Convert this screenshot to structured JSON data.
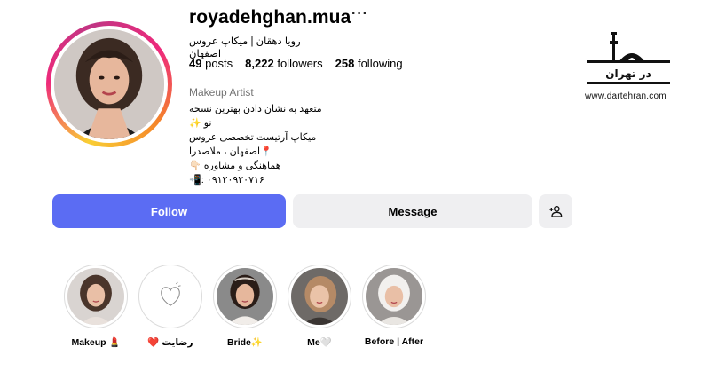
{
  "profile": {
    "username": "royadehghan.mua",
    "more_label": "···",
    "full_name": "رویا دهقان | میکاپ عروس اصفهان",
    "stats": {
      "posts_count": "49",
      "posts_label": "posts",
      "followers_count": "8,222",
      "followers_label": "followers",
      "following_count": "258",
      "following_label": "following"
    },
    "category": "Makeup Artist",
    "bio": [
      "متعهد به نشان دادن بهترین نسخه تو ✨",
      "میکاپ آرتیست تخصصی عروس",
      "📍اصفهان ، ملاصدرا",
      "هماهنگی و مشاوره 👇🏻",
      "📲: ۰۹۱۲۰۹۲۰۷۱۶"
    ]
  },
  "actions": {
    "follow_label": "Follow",
    "message_label": "Message",
    "add_user_icon": "person-add-icon"
  },
  "highlights": [
    {
      "label": "Makeup 💄",
      "icon": "portrait"
    },
    {
      "label": "رضایت ❤️",
      "icon": "heart-outline-icon"
    },
    {
      "label": "Bride✨",
      "icon": "portrait"
    },
    {
      "label": "Me🤍",
      "icon": "portrait"
    },
    {
      "label": "Before | After",
      "icon": "portrait"
    }
  ],
  "watermark": {
    "logo_text": "در تهران",
    "url": "www.dartehran.com"
  },
  "colors": {
    "follow_button": "#5b6cf3",
    "secondary_button": "#efeff1",
    "muted_text": "#737373"
  }
}
